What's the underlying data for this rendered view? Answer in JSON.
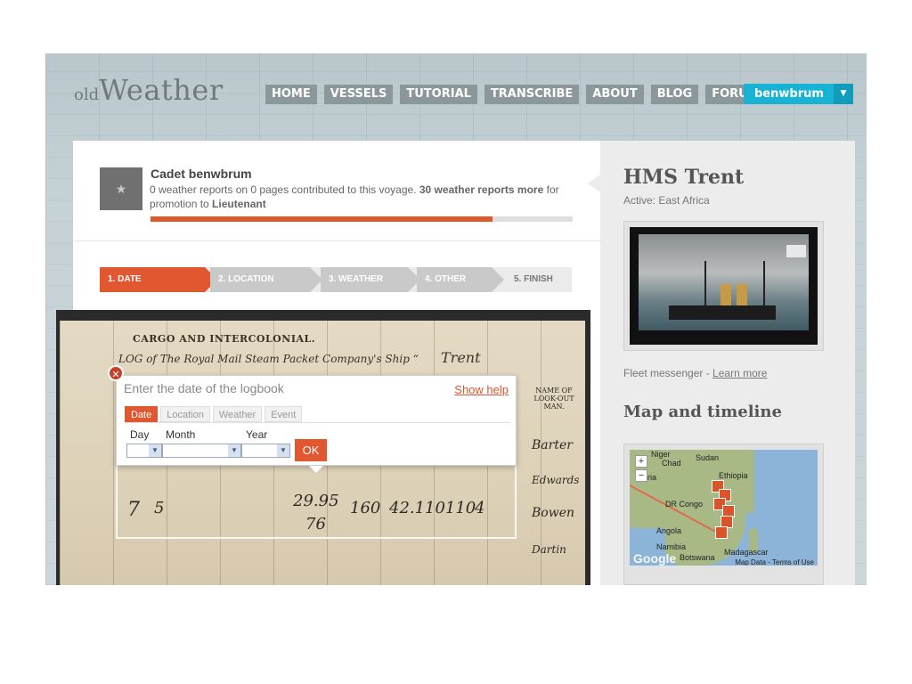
{
  "header": {
    "logo_small": "old",
    "logo_big": "Weather",
    "nav": [
      "HOME",
      "VESSELS",
      "TUTORIAL",
      "TRANSCRIBE",
      "ABOUT",
      "BLOG",
      "FORUM"
    ],
    "user": "benwbrum",
    "user_caret": "▼"
  },
  "profile": {
    "avatar_icon": "★",
    "name": "Cadet benwbrum",
    "desc_plain": "0 weather reports on 0 pages contributed to this voyage.",
    "desc_bold": "30 weather reports more",
    "desc_mid": "for promotion to",
    "desc_rank": "Lieutenant",
    "progress": 0.81
  },
  "steps": [
    "1. DATE",
    "2. LOCATION",
    "3. WEATHER",
    "4. OTHER",
    "5. FINISH"
  ],
  "logbook": {
    "heading": "CARGO AND INTERCOLONIAL.",
    "line": "LOG of The Royal Mail Steam Packet Company's Ship “",
    "ship_handwritten": "Trent",
    "col_header": "NAME OF LOOK-OUT MAN.",
    "hw_names": [
      "Barter",
      "Edwards",
      "Bowen",
      "Dartin"
    ],
    "hw_row1": [
      "7",
      "5",
      "29.95",
      "160",
      "42.1",
      "10110",
      "4"
    ],
    "hw_76": "76"
  },
  "popup": {
    "title": "Enter the date of the logbook",
    "help": "Show help",
    "tabs": [
      "Date",
      "Location",
      "Weather",
      "Event"
    ],
    "labels": [
      "Day",
      "Month",
      "Year"
    ],
    "ok": "OK",
    "close": "✕"
  },
  "sidebar": {
    "ship_name": "HMS Trent",
    "active": "Active: East Africa",
    "fleet": "Fleet messenger - ",
    "learn_more": "Learn more",
    "map_title": "Map and timeline",
    "map_labels": [
      "Niger",
      "Chad",
      "Sudan",
      "Ethiopia",
      "DR Congo",
      "Angola",
      "Namibia",
      "Botswana",
      "Madagascar",
      "ria"
    ],
    "zoom_in": "+",
    "zoom_out": "−",
    "google": "Google",
    "map_data": "Map Data",
    "terms": "Terms of Use"
  },
  "colors": {
    "accent": "#e05730",
    "user_btn": "#18b2d4",
    "nav_bg": "#8b979b"
  }
}
